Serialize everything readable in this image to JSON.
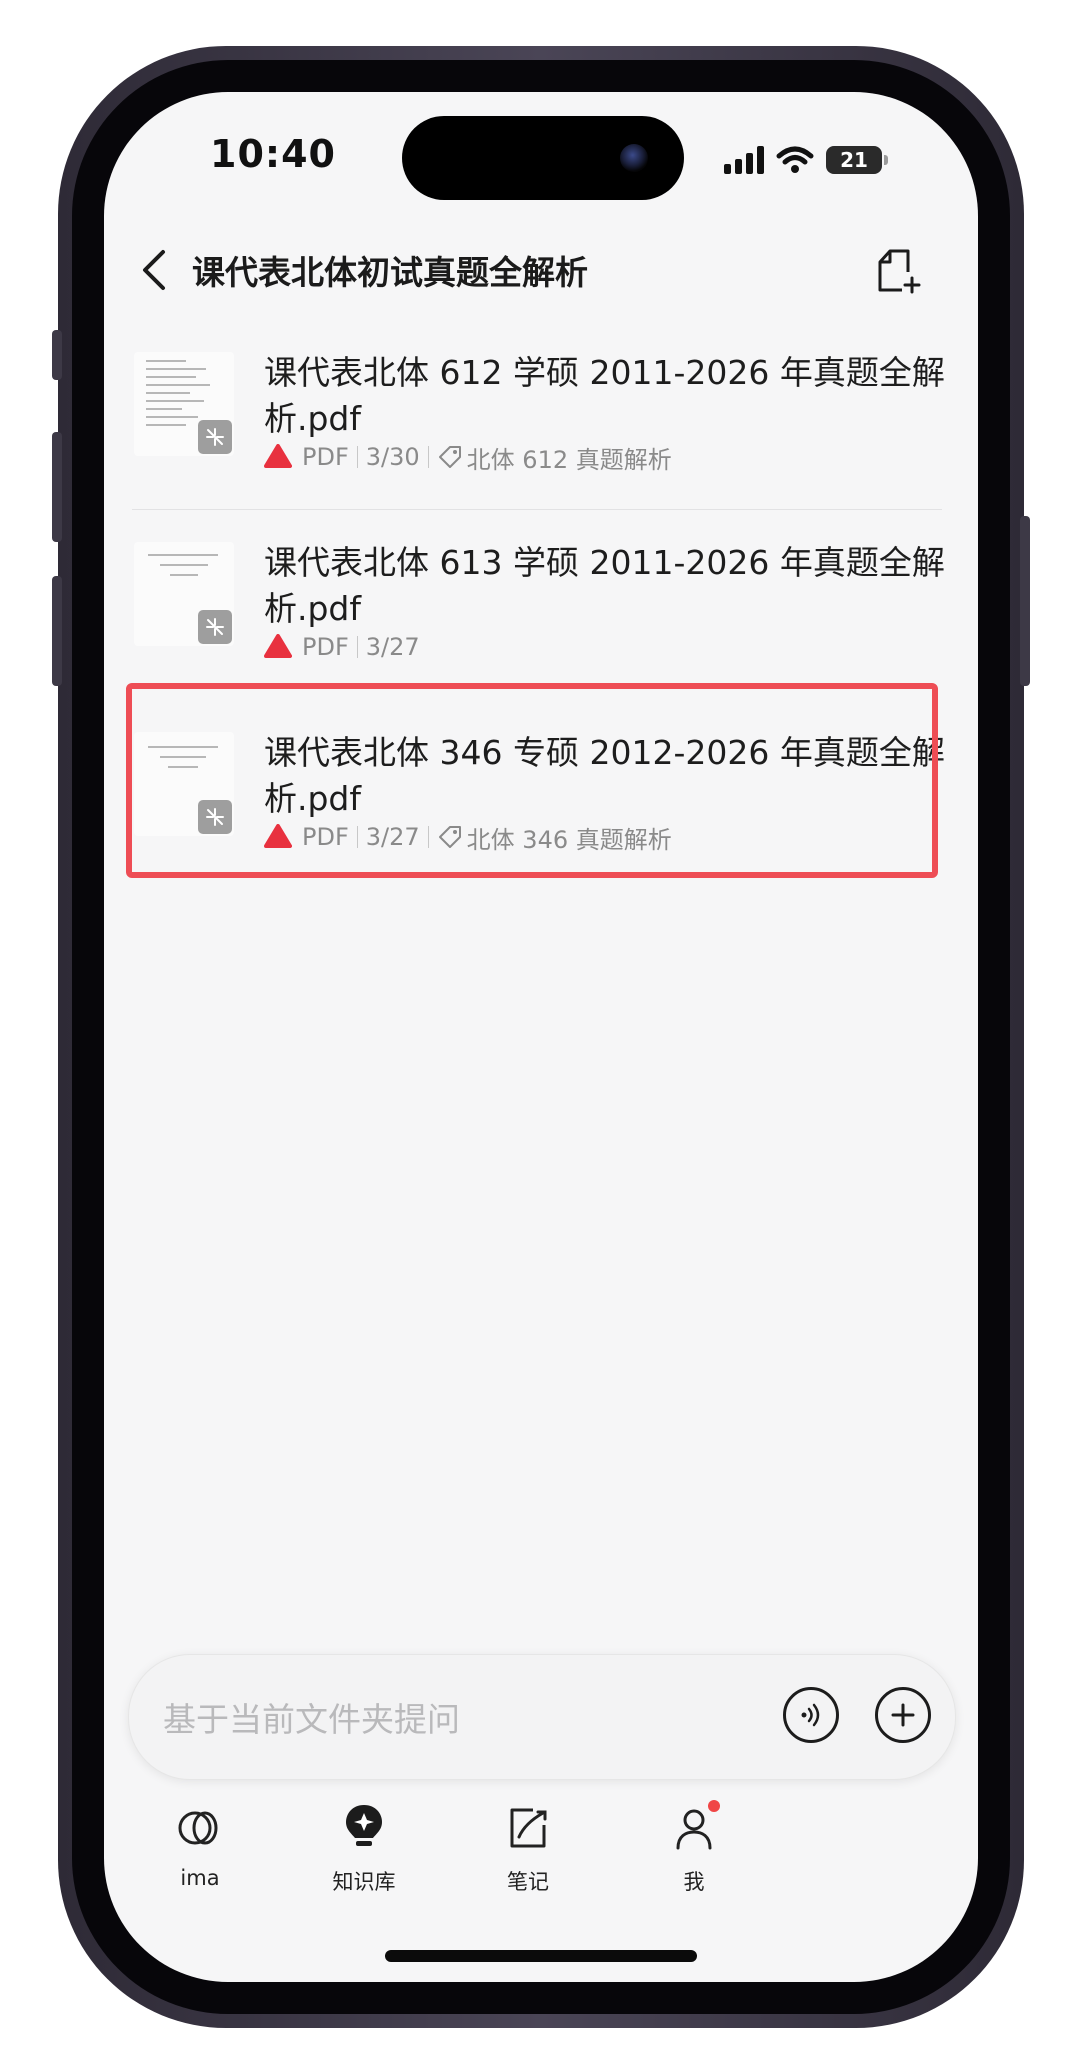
{
  "status_bar": {
    "time": "10:40",
    "battery": "21"
  },
  "navbar": {
    "title": "课代表北体初试真题全解析"
  },
  "files": [
    {
      "name": "课代表北体 612 学硕 2011-2026 年真题全解析.pdf",
      "type": "PDF",
      "date": "3/30",
      "tag": "北体 612 真题解析"
    },
    {
      "name": "课代表北体 613 学硕 2011-2026 年真题全解析.pdf",
      "type": "PDF",
      "date": "3/27",
      "tag": ""
    },
    {
      "name": "课代表北体 346 专硕 2012-2026 年真题全解析.pdf",
      "type": "PDF",
      "date": "3/27",
      "tag": "北体 346 真题解析"
    }
  ],
  "ask_bar": {
    "placeholder": "基于当前文件夹提问"
  },
  "tabs": [
    {
      "label": "ima",
      "icon": "ima-logo-icon"
    },
    {
      "label": "知识库",
      "icon": "knowledge-bulb-icon"
    },
    {
      "label": "笔记",
      "icon": "note-pen-icon"
    },
    {
      "label": "我",
      "icon": "person-icon"
    }
  ],
  "colors": {
    "highlight": "#ee4d55",
    "pdf_red": "#e8313f",
    "badge_dot": "#f04646"
  }
}
